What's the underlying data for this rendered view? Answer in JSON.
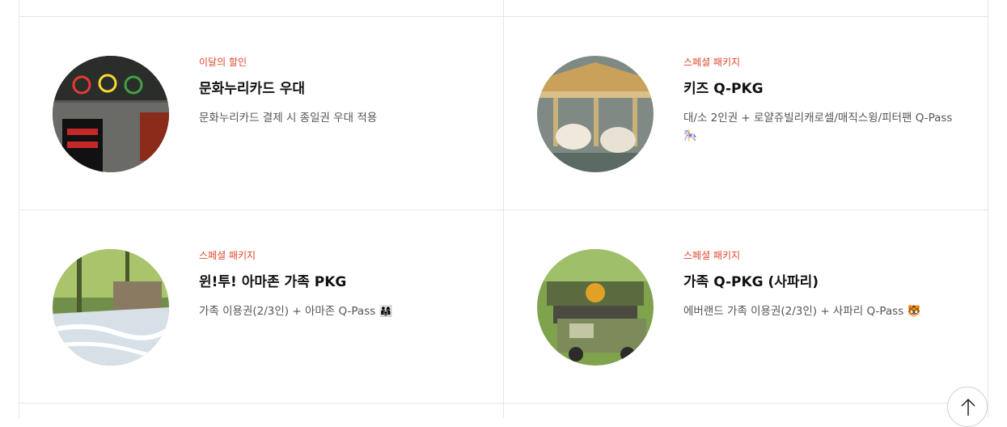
{
  "cards": [
    {
      "tag": "이달의 할인",
      "title": "문화누리카드 우대",
      "desc": "문화누리카드 결제 시 종일권 우대 적용"
    },
    {
      "tag": "스페셜 패키지",
      "title": "키즈 Q-PKG",
      "desc": "대/소 2인권 + 로얄쥬빌리캐로셀/매직스윙/피터팬 Q-Pass 🎠"
    },
    {
      "tag": "스페셜 패키지",
      "title": "윈!투! 아마존 가족 PKG",
      "desc": "가족 이용권(2/3인) + 아마존 Q-Pass 👨‍👩‍👧"
    },
    {
      "tag": "스페셜 패키지",
      "title": "가족 Q-PKG (사파리)",
      "desc": "에버랜드 가족 이용권(2/3인) + 사파리 Q-Pass 🐯"
    }
  ],
  "scroll_top": {
    "icon": "arrow-up-icon"
  }
}
